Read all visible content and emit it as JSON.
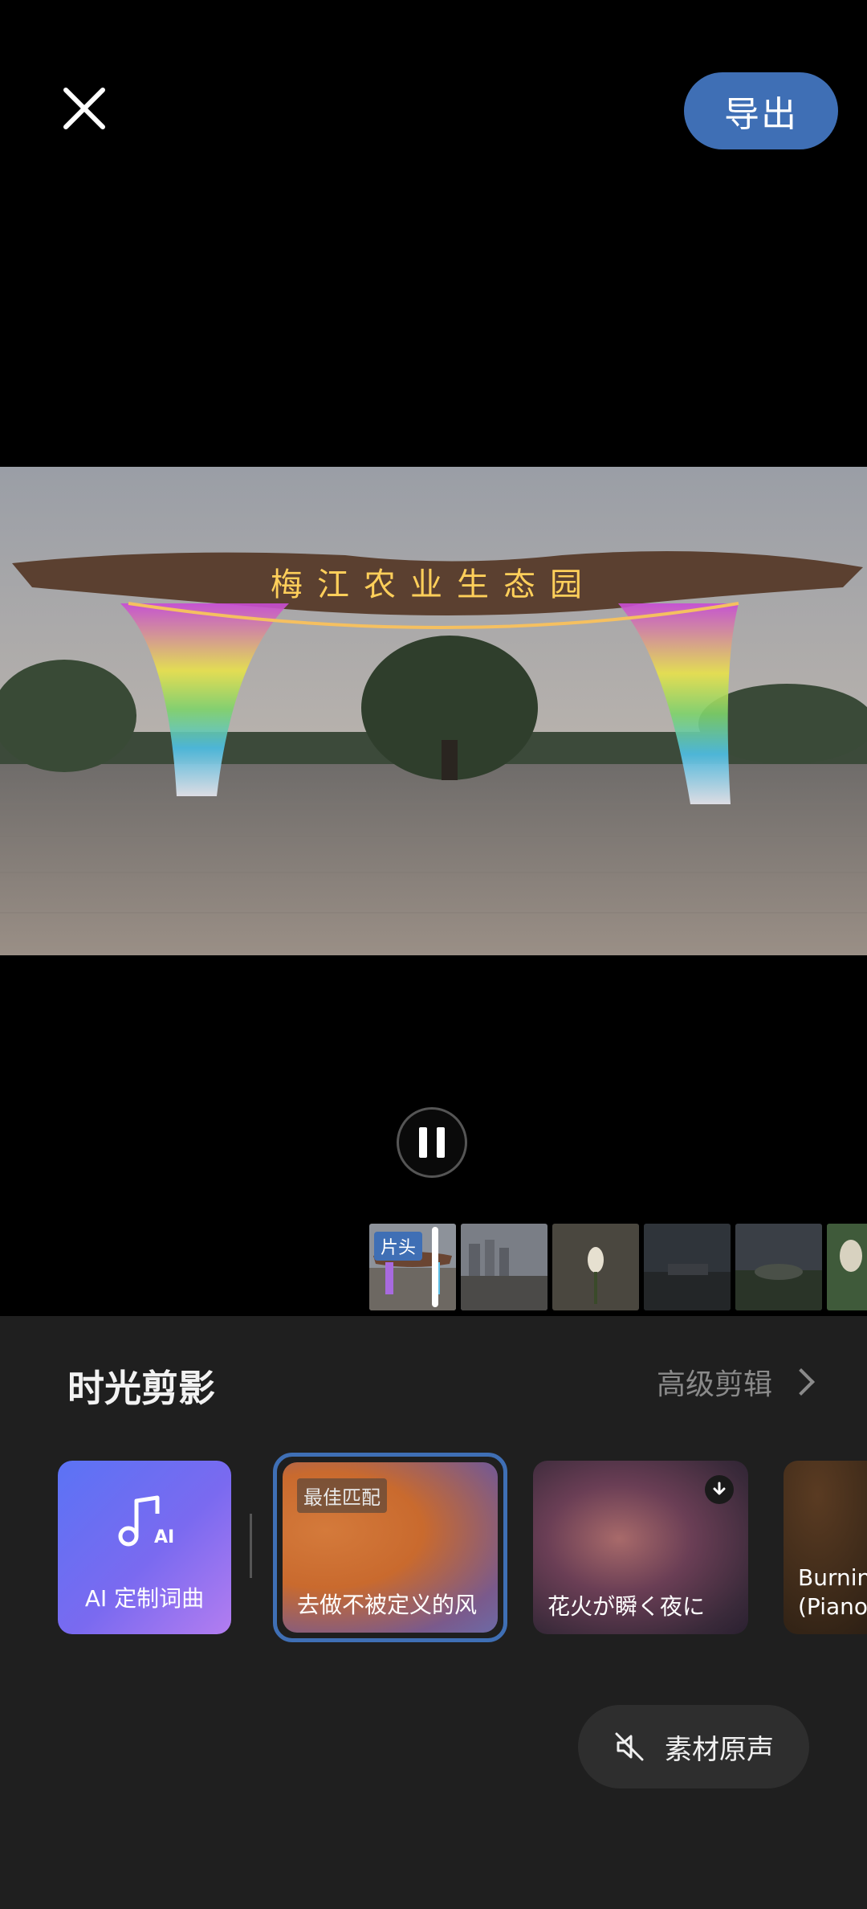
{
  "header": {
    "export_label": "导出"
  },
  "preview": {
    "sign_text": "梅江农业生态园"
  },
  "timeline": {
    "intro_label": "片头"
  },
  "panel": {
    "title": "时光剪影",
    "advanced_label": "高级剪辑",
    "ai_card_label": "AI 定制词曲",
    "ai_icon_text": "AI",
    "tracks": [
      {
        "badge": "最佳匹配",
        "title": "去做不被定义的风"
      },
      {
        "title": "花火が瞬く夜に"
      },
      {
        "title_line1": "Burnin",
        "title_line2": "(Piano"
      }
    ],
    "original_sound_label": "素材原声"
  },
  "colors": {
    "accent": "#3f6fb5",
    "panel_bg": "#1f1f1f"
  }
}
